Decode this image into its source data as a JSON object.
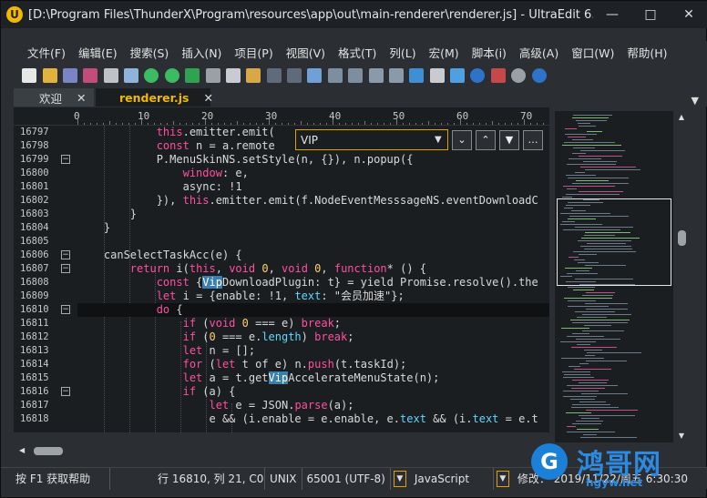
{
  "window": {
    "title": "[D:\\Program Files\\ThunderX\\Program\\resources\\app\\out\\main-renderer\\renderer.js] - UltraEdit 6..."
  },
  "menu": [
    "文件(F)",
    "编辑(E)",
    "搜索(S)",
    "插入(N)",
    "项目(P)",
    "视图(V)",
    "格式(T)",
    "列(L)",
    "宏(M)",
    "脚本(i)",
    "高级(A)",
    "窗口(W)",
    "帮助(H)"
  ],
  "tabs": [
    {
      "label": "欢迎",
      "active": false
    },
    {
      "label": "renderer.js",
      "active": true
    }
  ],
  "ruler": [
    "0",
    "10",
    "20",
    "30",
    "40",
    "50",
    "60",
    "70"
  ],
  "line_numbers": [
    "16797",
    "16798",
    "16799",
    "16800",
    "16801",
    "16802",
    "16803",
    "16804",
    "16805",
    "16806",
    "16807",
    "16808",
    "16809",
    "16810",
    "16811",
    "16812",
    "16813",
    "16814",
    "16815",
    "16816",
    "16817",
    "16818"
  ],
  "find": {
    "value": "VIP"
  },
  "status": {
    "help": "按 F1 获取帮助",
    "position": "行 16810, 列 21, C0",
    "line_ending": "UNIX",
    "encoding": "65001 (UTF-8)",
    "language": "JavaScript",
    "modified": "修改： 2019/11/22/周五 6:30:30"
  },
  "watermark": {
    "brand": "鸿哥网",
    "url": "hgyw.net"
  },
  "colors": {
    "accent": "#f2b705",
    "keyword": "#ff4fa0",
    "property": "#5fd7ff",
    "highlight": "#3a7fb0"
  }
}
